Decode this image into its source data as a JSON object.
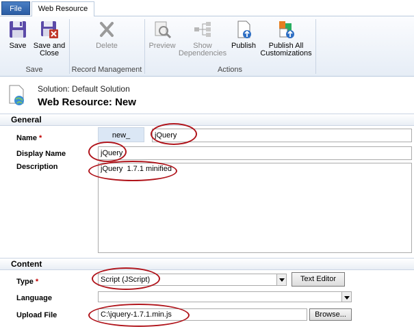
{
  "tabs": {
    "file": "File",
    "web_resource": "Web Resource"
  },
  "ribbon": {
    "save": "Save",
    "save_close_1": "Save and",
    "save_close_2": "Close",
    "delete": "Delete",
    "preview": "Preview",
    "show_dep_1": "Show",
    "show_dep_2": "Dependencies",
    "publish": "Publish",
    "publish_all_1": "Publish All",
    "publish_all_2": "Customizations",
    "groups": {
      "save": "Save",
      "record": "Record Management",
      "actions": "Actions"
    }
  },
  "header": {
    "solution": "Solution: Default Solution",
    "title": "Web Resource: New"
  },
  "general": {
    "heading": "General",
    "name_label": "Name",
    "name_prefix": "new_",
    "name_value": "jQuery",
    "display_label": "Display Name",
    "display_value": "jQuery",
    "desc_label": "Description",
    "desc_value": "jQuery  1.7.1 minified"
  },
  "content": {
    "heading": "Content",
    "type_label": "Type",
    "type_value": "Script (JScript)",
    "text_editor": "Text Editor",
    "language_label": "Language",
    "language_value": "",
    "upload_label": "Upload File",
    "upload_value": "C:\\jquery-1.7.1.min.js",
    "browse": "Browse..."
  },
  "required_marker": "*"
}
